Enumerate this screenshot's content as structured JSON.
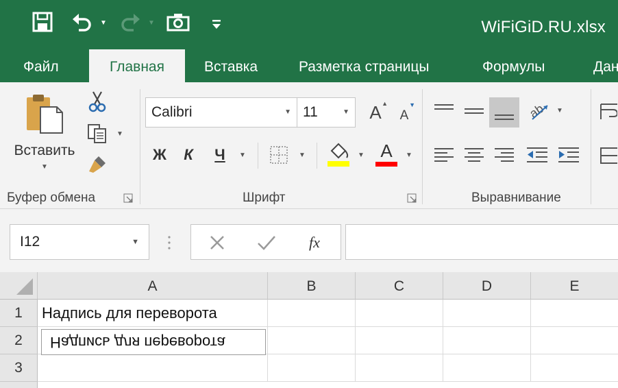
{
  "window": {
    "filename": "WiFiGiD.RU.xlsx"
  },
  "qat": {
    "icons": [
      "save-icon",
      "undo-icon",
      "redo-icon",
      "camera-icon",
      "customize-qat-icon"
    ]
  },
  "tabs": [
    "Файл",
    "Главная",
    "Вставка",
    "Разметка страницы",
    "Формулы",
    "Дан"
  ],
  "active_tab": "Главная",
  "ribbon": {
    "clipboard": {
      "paste_label": "Вставить",
      "group_label": "Буфер обмена"
    },
    "font": {
      "font_name": "Calibri",
      "font_size": "11",
      "bold": "Ж",
      "italic": "К",
      "underline": "Ч",
      "grow": "A",
      "shrink": "A",
      "font_color_letter": "A",
      "group_label": "Шрифт"
    },
    "alignment": {
      "group_label": "Выравнивание"
    }
  },
  "formula_bar": {
    "name_box": "I12",
    "fx": "fx",
    "formula": ""
  },
  "grid": {
    "columns": [
      "A",
      "B",
      "C",
      "D",
      "E"
    ],
    "rows": [
      "1",
      "2",
      "3"
    ],
    "cells": {
      "A1": "Надпись для переворота",
      "A2": "Надпись для переворота"
    }
  },
  "colors": {
    "accent": "#217346",
    "fill_color": "#ffff00",
    "font_color": "#ff0000"
  }
}
